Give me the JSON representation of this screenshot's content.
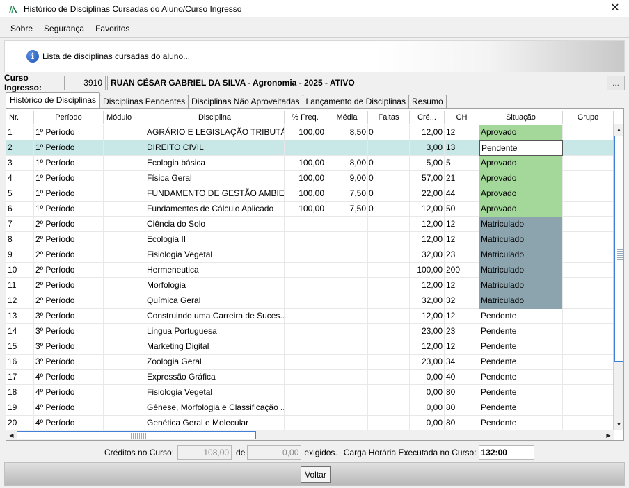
{
  "window": {
    "title": "Histórico de Disciplinas Cursadas do Aluno/Curso Ingresso",
    "close": "✕"
  },
  "menu": [
    "Sobre",
    "Segurança",
    "Favoritos"
  ],
  "info": {
    "text": "Lista de disciplinas cursadas do aluno...",
    "icon": "i"
  },
  "course": {
    "label": "Curso Ingresso:",
    "code": "3910",
    "name": "RUAN CÉSAR GABRIEL DA SILVA - Agronomia - 2025 - ATIVO",
    "lookup": "..."
  },
  "tabs": [
    "Histórico de Disciplinas",
    "Disciplinas Pendentes",
    "Disciplinas Não Aproveitadas",
    "Lançamento de Disciplinas",
    "Resumo"
  ],
  "columns": [
    "Nr.",
    "Período",
    "Módulo",
    "Disciplina",
    "% Freq.",
    "Média",
    "Faltas",
    "Cré...",
    "CH",
    "Situação",
    "Grupo"
  ],
  "rows": [
    {
      "nr": "1",
      "periodo": "1º Período",
      "modulo": "",
      "disciplina": "AGRÁRIO E LEGISLAÇÃO TRIBUTÁRIA",
      "freq": "100,00",
      "media": "8,50",
      "faltas": "0",
      "creditos": "12,00",
      "ch": "12",
      "situacao": "Aprovado",
      "grupo": ""
    },
    {
      "nr": "2",
      "periodo": "1º Período",
      "modulo": "",
      "disciplina": "DIREITO CIVIL",
      "freq": "",
      "media": "",
      "faltas": "",
      "creditos": "3,00",
      "ch": "13",
      "situacao": "Pendente",
      "grupo": ""
    },
    {
      "nr": "3",
      "periodo": "1º Período",
      "modulo": "",
      "disciplina": "Ecologia básica",
      "freq": "100,00",
      "media": "8,00",
      "faltas": "0",
      "creditos": "5,00",
      "ch": "5",
      "situacao": "Aprovado",
      "grupo": ""
    },
    {
      "nr": "4",
      "periodo": "1º Período",
      "modulo": "",
      "disciplina": "Física Geral",
      "freq": "100,00",
      "media": "9,00",
      "faltas": "0",
      "creditos": "57,00",
      "ch": "21",
      "situacao": "Aprovado",
      "grupo": ""
    },
    {
      "nr": "5",
      "periodo": "1º Período",
      "modulo": "",
      "disciplina": "FUNDAMENTO DE GESTÃO AMBIE...",
      "freq": "100,00",
      "media": "7,50",
      "faltas": "0",
      "creditos": "22,00",
      "ch": "44",
      "situacao": "Aprovado",
      "grupo": ""
    },
    {
      "nr": "6",
      "periodo": "1º Período",
      "modulo": "",
      "disciplina": "Fundamentos de Cálculo Aplicado",
      "freq": "100,00",
      "media": "7,50",
      "faltas": "0",
      "creditos": "12,00",
      "ch": "50",
      "situacao": "Aprovado",
      "grupo": ""
    },
    {
      "nr": "7",
      "periodo": "2º Período",
      "modulo": "",
      "disciplina": "Ciência do Solo",
      "freq": "",
      "media": "",
      "faltas": "",
      "creditos": "12,00",
      "ch": "12",
      "situacao": "Matriculado",
      "grupo": ""
    },
    {
      "nr": "8",
      "periodo": "2º Período",
      "modulo": "",
      "disciplina": "Ecologia II",
      "freq": "",
      "media": "",
      "faltas": "",
      "creditos": "12,00",
      "ch": "12",
      "situacao": "Matriculado",
      "grupo": ""
    },
    {
      "nr": "9",
      "periodo": "2º Período",
      "modulo": "",
      "disciplina": "Fisiologia Vegetal",
      "freq": "",
      "media": "",
      "faltas": "",
      "creditos": "32,00",
      "ch": "23",
      "situacao": "Matriculado",
      "grupo": ""
    },
    {
      "nr": "10",
      "periodo": "2º Período",
      "modulo": "",
      "disciplina": "Hermeneutica",
      "freq": "",
      "media": "",
      "faltas": "",
      "creditos": "100,00",
      "ch": "200",
      "situacao": "Matriculado",
      "grupo": ""
    },
    {
      "nr": "11",
      "periodo": "2º Período",
      "modulo": "",
      "disciplina": "Morfologia",
      "freq": "",
      "media": "",
      "faltas": "",
      "creditos": "12,00",
      "ch": "12",
      "situacao": "Matriculado",
      "grupo": ""
    },
    {
      "nr": "12",
      "periodo": "2º Período",
      "modulo": "",
      "disciplina": "Química Geral",
      "freq": "",
      "media": "",
      "faltas": "",
      "creditos": "32,00",
      "ch": "32",
      "situacao": "Matriculado",
      "grupo": ""
    },
    {
      "nr": "13",
      "periodo": "3º Período",
      "modulo": "",
      "disciplina": "Construindo uma Carreira de Suces...",
      "freq": "",
      "media": "",
      "faltas": "",
      "creditos": "12,00",
      "ch": "12",
      "situacao": "Pendente",
      "grupo": ""
    },
    {
      "nr": "14",
      "periodo": "3º Período",
      "modulo": "",
      "disciplina": "Lingua Portuguesa",
      "freq": "",
      "media": "",
      "faltas": "",
      "creditos": "23,00",
      "ch": "23",
      "situacao": "Pendente",
      "grupo": ""
    },
    {
      "nr": "15",
      "periodo": "3º Período",
      "modulo": "",
      "disciplina": "Marketing Digital",
      "freq": "",
      "media": "",
      "faltas": "",
      "creditos": "12,00",
      "ch": "12",
      "situacao": "Pendente",
      "grupo": ""
    },
    {
      "nr": "16",
      "periodo": "3º Período",
      "modulo": "",
      "disciplina": "Zoologia Geral",
      "freq": "",
      "media": "",
      "faltas": "",
      "creditos": "23,00",
      "ch": "34",
      "situacao": "Pendente",
      "grupo": ""
    },
    {
      "nr": "17",
      "periodo": "4º Período",
      "modulo": "",
      "disciplina": "Expressão Gráfica",
      "freq": "",
      "media": "",
      "faltas": "",
      "creditos": "0,00",
      "ch": "40",
      "situacao": "Pendente",
      "grupo": ""
    },
    {
      "nr": "18",
      "periodo": "4º Período",
      "modulo": "",
      "disciplina": "Fisiologia Vegetal",
      "freq": "",
      "media": "",
      "faltas": "",
      "creditos": "0,00",
      "ch": "80",
      "situacao": "Pendente",
      "grupo": ""
    },
    {
      "nr": "19",
      "periodo": "4º Período",
      "modulo": "",
      "disciplina": "Gênese, Morfologia e Classificação ...",
      "freq": "",
      "media": "",
      "faltas": "",
      "creditos": "0,00",
      "ch": "80",
      "situacao": "Pendente",
      "grupo": ""
    },
    {
      "nr": "20",
      "periodo": "4º Período",
      "modulo": "",
      "disciplina": "Genética Geral e Molecular",
      "freq": "",
      "media": "",
      "faltas": "",
      "creditos": "0,00",
      "ch": "80",
      "situacao": "Pendente",
      "grupo": ""
    }
  ],
  "selected_row": 2,
  "status_colors": {
    "Aprovado": "#a4d89a",
    "Matriculado": "#8ca4ae",
    "selected_row": "#c8e8e8"
  },
  "footer": {
    "creditos_label": "Créditos no Curso:",
    "creditos_value": "108,00",
    "de_label": "de",
    "exigidos_value": "0,00",
    "exigidos_label": "exigidos.",
    "carga_label": "Carga Horária Executada no Curso:",
    "carga_value": "132:00"
  },
  "buttons": {
    "back": "Voltar"
  },
  "scroll": {
    "up": "▲",
    "down": "▼",
    "left": "◀",
    "right": "▶"
  }
}
